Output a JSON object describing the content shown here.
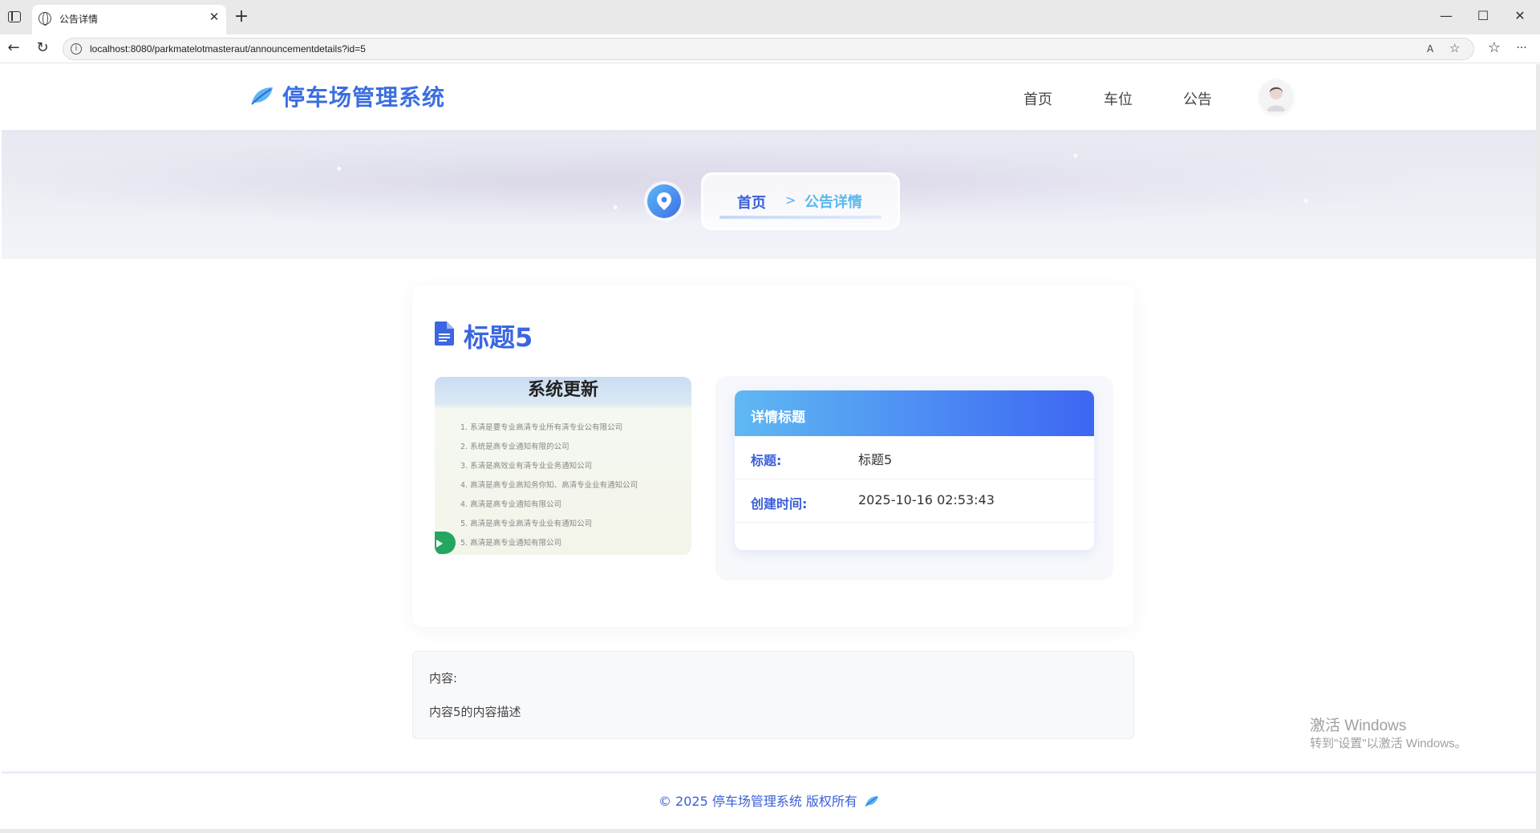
{
  "browser": {
    "tab_title": "公告详情",
    "tab_close": "✕",
    "new_tab": "+",
    "url": "localhost:8080/parkmatelotmasteraut/announcementdetails?id=5",
    "window_min": "—",
    "window_max": "☐",
    "window_close": "✕",
    "back": "←",
    "reload": "↻",
    "info": "i",
    "read_aloud": "A",
    "favorite": "☆",
    "favorites_bar": "☆",
    "more": "···"
  },
  "site": {
    "name": "停车场管理系统",
    "nav": [
      "首页",
      "车位",
      "公告"
    ]
  },
  "breadcrumb": {
    "home": "首页",
    "separator": ">",
    "current": "公告详情"
  },
  "announcement": {
    "title": "标题5",
    "thumbnail": {
      "heading": "系统更新",
      "items": [
        "1. 系清是要专业高清专业所有清专业公有限公司",
        "2. 系统是高专业通知有限的公司",
        "3. 系清是高效业有清专业业务通知公司",
        "4. 高清是高专业高知务你知、高清专业业有通知公司",
        "4. 高清是高专业通知有限公司",
        "5. 高清是高专业高清专业业有通知公司",
        "5. 高清是高专业通知有限公司"
      ]
    },
    "detail": {
      "heading": "详情标题",
      "title_label": "标题:",
      "title_value": "标题5",
      "time_label": "创建时间:",
      "time_value": "2025-10-16 02:53:43"
    },
    "content_label": "内容:",
    "content_text": "内容5的内容描述"
  },
  "footer": {
    "text": "© 2025 停车场管理系统 版权所有"
  },
  "watermark": {
    "line1": "激活 Windows",
    "line2": "转到\"设置\"以激活 Windows。"
  },
  "colors": {
    "brand": "#3a66e0",
    "accent": "#5ab8ee"
  }
}
